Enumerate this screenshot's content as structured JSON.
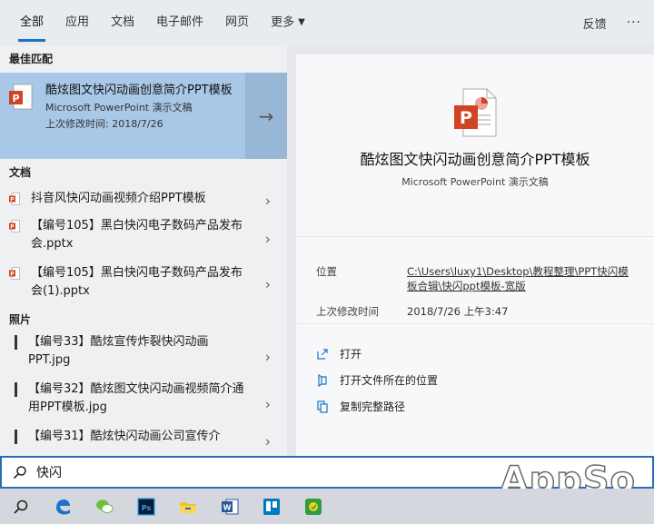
{
  "tabs": [
    {
      "label": "全部"
    },
    {
      "label": "应用"
    },
    {
      "label": "文档"
    },
    {
      "label": "电子邮件"
    },
    {
      "label": "网页"
    },
    {
      "label": "更多"
    }
  ],
  "feedback_label": "反馈",
  "more_menu_label": "···",
  "sections": {
    "best_match": "最佳匹配",
    "documents": "文档",
    "photos": "照片"
  },
  "best_match": {
    "title": "酷炫图文快闪动画创意简介PPT模板",
    "type": "Microsoft PowerPoint 演示文稿",
    "modified": "上次修改时间: 2018/7/26"
  },
  "documents": [
    {
      "name": "抖音风快闪动画视频介绍PPT模板"
    },
    {
      "name": "【编号105】黑白快闪电子数码产品发布会.pptx"
    },
    {
      "name": "【编号105】黑白快闪电子数码产品发布会(1).pptx"
    }
  ],
  "photos": [
    {
      "name": "【编号33】酷炫宣传炸裂快闪动画PPT.jpg"
    },
    {
      "name": "【编号32】酷炫图文快闪动画视频简介通用PPT模板.jpg"
    },
    {
      "name": "【编号31】酷炫快闪动画公司宣传介"
    }
  ],
  "preview": {
    "title": "酷炫图文快闪动画创意简介PPT模板",
    "subtitle": "Microsoft PowerPoint 演示文稿",
    "location_label": "位置",
    "location_value": "C:\\Users\\luxy1\\Desktop\\教程整理\\PPT快闪模板合辑\\快闪ppt模板-宽版",
    "modified_label": "上次修改时间",
    "modified_value": "2018/7/26 上午3:47",
    "actions": [
      {
        "label": "打开"
      },
      {
        "label": "打开文件所在的位置"
      },
      {
        "label": "复制完整路径"
      }
    ]
  },
  "search": {
    "query": "快闪"
  },
  "watermark": "AppSo",
  "colors": {
    "accent": "#1a73c9",
    "best_match_bg": "#a9c8e8",
    "ppt_orange": "#d04423"
  },
  "taskbar_icons": [
    "search-icon",
    "edge-icon",
    "wechat-icon",
    "photoshop-icon",
    "file-explorer-icon",
    "word-icon",
    "trello-icon",
    "app-icon"
  ]
}
